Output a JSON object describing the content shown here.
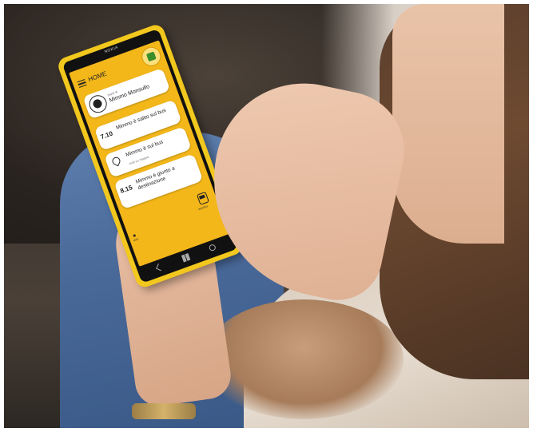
{
  "phone": {
    "brand": "NOKIA",
    "app": {
      "header": {
        "title": "HOME"
      },
      "user": {
        "caption": "papà di",
        "name": "Mimmo Monsullo"
      },
      "events": [
        {
          "time": "7.10",
          "text": "Mimmo è salito sul bus",
          "subtext": ""
        },
        {
          "time": "",
          "text": "Mimmo è sul bus",
          "subtext": "vedi su mappa"
        },
        {
          "time": "8.15",
          "text": "Mimmo è giunto a destinazione",
          "subtext": ""
        }
      ],
      "footer": {
        "start_label": "start",
        "bus_label": "autobus"
      }
    }
  },
  "colors": {
    "phone_body": "#f2c81e",
    "app_background": "#f3b71a",
    "card": "#ffffff"
  }
}
